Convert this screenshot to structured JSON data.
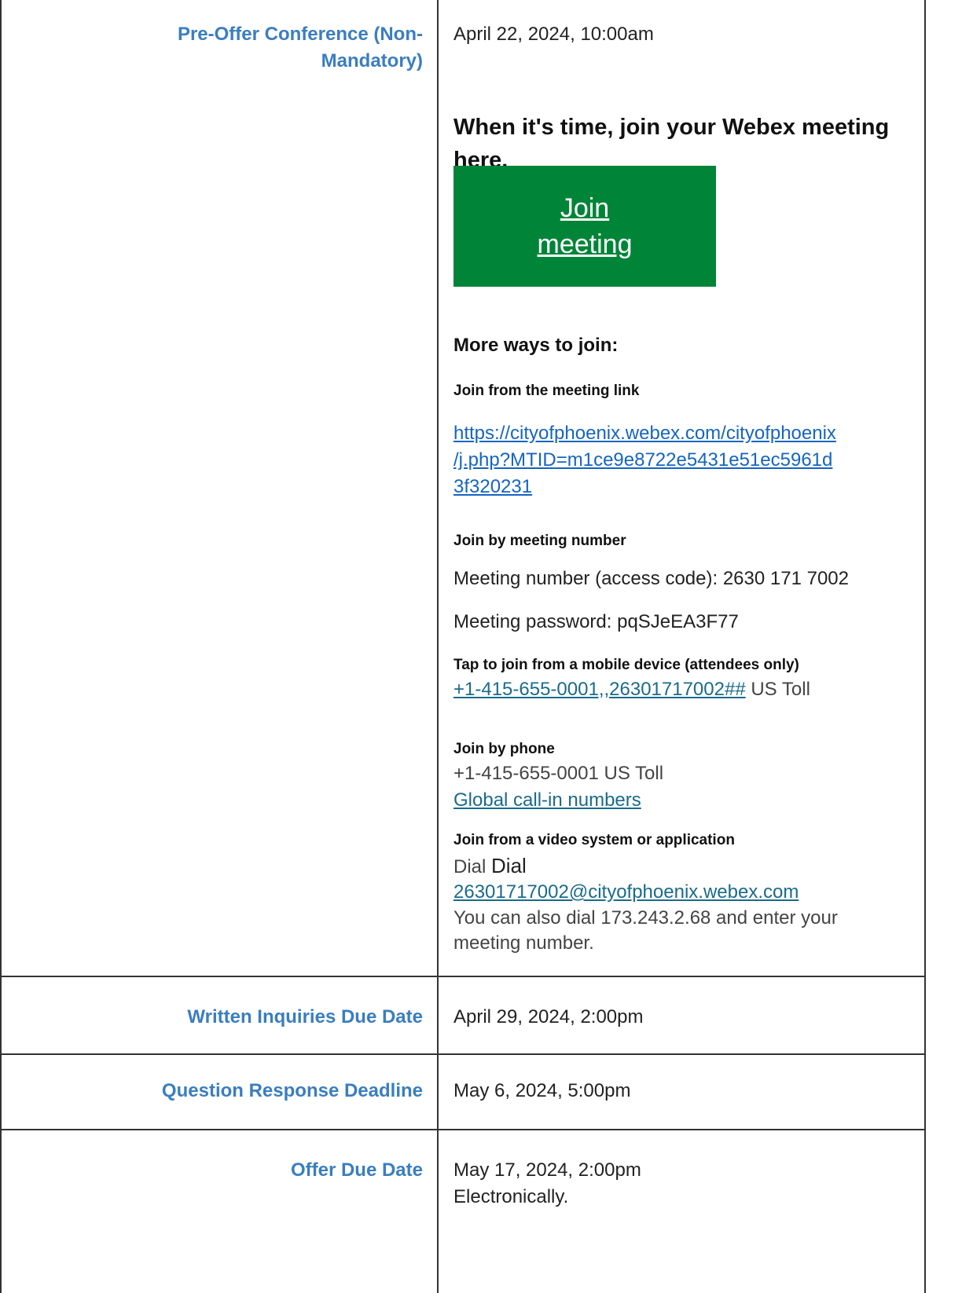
{
  "rows": [
    {
      "label_line1": "Pre-Offer Conference (Non-",
      "label_line2": "Mandatory)",
      "value": "April 22, 2024, 10:00am"
    },
    {
      "label": "Written Inquiries Due Date",
      "value": "April 29, 2024, 2:00pm"
    },
    {
      "label": "Question Response Deadline",
      "value": "May 6, 2024, 5:00pm"
    },
    {
      "label": "Offer Due Date",
      "value_line1": "May 17, 2024, 2:00pm",
      "value_line2": "Electronically."
    }
  ],
  "webex": {
    "heading_line1": "When it's time, join your Webex meeting",
    "heading_line2": "here.",
    "join_button_line1": "Join",
    "join_button_line2": "meeting",
    "more_ways": "More ways to join:",
    "link_heading": "Join from the meeting link",
    "link_line1": "https://cityofphoenix.webex.com/cityofphoenix",
    "link_line2": "/j.php?MTID=m1ce9e8722e5431e51ec5961d",
    "link_line3": "3f320231",
    "number_heading": "Join by meeting number",
    "meeting_number": "Meeting number (access code): 2630 171 7002",
    "meeting_password": "Meeting password: pqSJeEA3F77",
    "mobile_heading": "Tap to join from a mobile device (attendees only)",
    "mobile_link": "+1-415-655-0001,,26301717002##",
    "mobile_suffix": " US Toll",
    "phone_heading": "Join by phone",
    "phone_number": "+1-415-655-0001 US Toll",
    "global_link": "Global call-in numbers",
    "video_heading": "Join from a video system or application",
    "dial_prefix1": "Dial ",
    "dial_prefix2": "Dial",
    "video_address": "26301717002@cityofphoenix.webex.com",
    "video_note_line1": "You can also dial 173.243.2.68 and enter your",
    "video_note_line2": "meeting number."
  }
}
